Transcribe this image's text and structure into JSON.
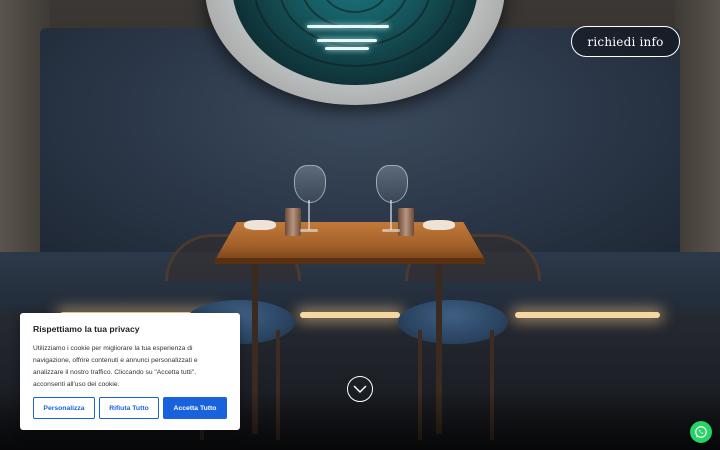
{
  "header": {
    "info_button_label": "richiedi info"
  },
  "cookie_banner": {
    "title": "Rispettiamo la tua privacy",
    "text": "Utilizziamo i cookie per migliorare la tua esperienza di navigazione, offrire contenuti e annunci personalizzati e analizzare il nostro traffico. Cliccando su \"Accetta tutti\", acconsenti all'uso dei cookie.",
    "buttons": {
      "customize": "Personalizza",
      "reject": "Rifiuta Tutto",
      "accept": "Accetta Tutto"
    }
  },
  "icons": {
    "scroll": "chevron-down-icon",
    "chat": "whatsapp-icon"
  },
  "colors": {
    "accent": "#1863dc",
    "whatsapp": "#25d366"
  }
}
